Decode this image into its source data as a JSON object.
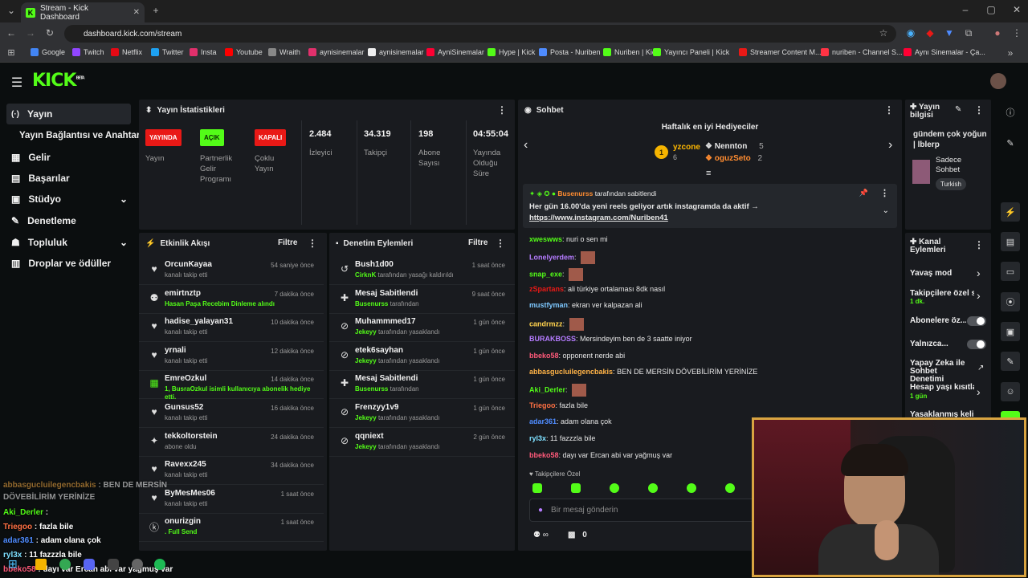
{
  "browser": {
    "tab_title": "Stream - Kick Dashboard",
    "url": "dashboard.kick.com/stream",
    "bookmarks": [
      "Google",
      "Twitch",
      "Netflix",
      "Twitter",
      "Insta",
      "Youtube",
      "Wraith",
      "aynisinemalar",
      "aynisinemalar",
      "AyniSinemalar",
      "Hype | Kick",
      "Posta - Nuriben",
      "Nuriben | Kick",
      "Yayıncı Paneli | Kick",
      "Streamer Content M...",
      "nuriben - Channel S...",
      "Aynı Sinemalar - Ça..."
    ]
  },
  "app": {
    "logo": "KICK",
    "logo_beta": "BETA"
  },
  "sidebar": {
    "items": [
      {
        "label": "Yayın",
        "icon": "broadcast-icon"
      },
      {
        "label": "Yayın Bağlantısı ve Anahtarı"
      },
      {
        "label": "Gelir",
        "icon": "revenue-icon"
      },
      {
        "label": "Başarılar",
        "icon": "achievements-icon"
      },
      {
        "label": "Stüdyo",
        "icon": "studio-icon"
      },
      {
        "label": "Denetleme",
        "icon": "wrench-icon"
      },
      {
        "label": "Topluluk",
        "icon": "community-icon"
      },
      {
        "label": "Droplar ve ödüller",
        "icon": "gift-icon"
      }
    ]
  },
  "stats": {
    "title": "Yayın İstatistikleri",
    "badges": [
      {
        "badge": "YAYINDA",
        "label": "Yayın",
        "color": "#e91916"
      },
      {
        "badge": "AÇIK",
        "label": "Partnerlik Gelir Programı",
        "color": "#53fc18"
      },
      {
        "badge": "KAPALI",
        "label": "Çoklu Yayın",
        "color": "#e91916"
      }
    ],
    "values": [
      {
        "value": "2.484",
        "label": "İzleyici"
      },
      {
        "value": "34.319",
        "label": "Takipçi"
      },
      {
        "value": "198",
        "label": "Abone Sayısı"
      },
      {
        "value": "04:55:04",
        "label": "Yayında Olduğu Süre"
      }
    ]
  },
  "activity": {
    "title": "Etkinlik Akışı",
    "filter": "Filtre",
    "rows": [
      {
        "name": "OrcunKayaa",
        "sub": "kanalı takip etti",
        "time": "54 saniye önce",
        "icon": "heart-icon"
      },
      {
        "name": "emirtnztp",
        "sub": "Hasan Paşa Recebim Dinleme alındı",
        "time": "7 dakika önce",
        "icon": "redeem-icon"
      },
      {
        "name": "hadise_yalayan31",
        "sub": "kanalı takip etti",
        "time": "10 dakika önce",
        "icon": "heart-icon"
      },
      {
        "name": "yrnali",
        "sub": "kanalı takip etti",
        "time": "12 dakika önce",
        "icon": "heart-icon"
      },
      {
        "name": "EmreOzkul",
        "sub": "1, BusraOzkul isimli kullanıcıya abonelik hediye etti.",
        "time": "14 dakika önce",
        "icon": "gift-sub-icon"
      },
      {
        "name": "Gunsus52",
        "sub": "kanalı takip etti",
        "time": "16 dakika önce",
        "icon": "heart-icon"
      },
      {
        "name": "tekkoltorstein",
        "sub": "abone oldu",
        "time": "24 dakika önce",
        "icon": "star-icon"
      },
      {
        "name": "Ravexx245",
        "sub": "kanalı takip etti",
        "time": "34 dakika önce",
        "icon": "heart-icon"
      },
      {
        "name": "ByMesMes06",
        "sub": "kanalı takip etti",
        "time": "1 saat önce",
        "icon": "heart-icon"
      },
      {
        "name": "onurizgin",
        "sub": ". Full Send",
        "time": "1 saat önce",
        "icon": "kick-icon"
      }
    ]
  },
  "moderation": {
    "title": "Denetim Eylemleri",
    "filter": "Filtre",
    "rows": [
      {
        "name": "Bush1d00",
        "sub_user": "CirknK",
        "sub": "tarafından yasağı kaldırıldı",
        "time": "1 saat önce",
        "icon": "undo-icon"
      },
      {
        "name": "Mesaj Sabitlendi",
        "sub_user": "Busenurss",
        "sub": "tarafından",
        "time": "9 saat önce",
        "icon": "pin-icon"
      },
      {
        "name": "Muhammmed17",
        "sub_user": "Jekeyy",
        "sub": "tarafından yasaklandı",
        "time": "1 gün önce",
        "icon": "ban-icon"
      },
      {
        "name": "etek6sayhan",
        "sub_user": "Jekeyy",
        "sub": "tarafından yasaklandı",
        "time": "1 gün önce",
        "icon": "ban-icon"
      },
      {
        "name": "Mesaj Sabitlendi",
        "sub_user": "Busenurss",
        "sub": "tarafından",
        "time": "1 gün önce",
        "icon": "pin-icon"
      },
      {
        "name": "Frenzyy1v9",
        "sub_user": "Jekeyy",
        "sub": "tarafından yasaklandı",
        "time": "1 gün önce",
        "icon": "ban-icon"
      },
      {
        "name": "qqniext",
        "sub_user": "Jekeyy",
        "sub": "tarafından yasaklandı",
        "time": "2 gün önce",
        "icon": "ban-icon"
      }
    ]
  },
  "chat": {
    "title": "Sohbet",
    "gifters_title": "Haftalık en iyi Hediyeciler",
    "gifters": [
      {
        "rank": "1",
        "name": "yzcone",
        "count": "6"
      },
      {
        "name": "Nennton",
        "count": "5"
      },
      {
        "name": "oguzSeto",
        "count": "2"
      }
    ],
    "pinned_by_user": "Busenurss",
    "pinned_by_suffix": "tarafından sabitlendi",
    "pinned_text": "Her gün 16.00'da yeni reels geliyor artık instagramda da aktif →",
    "pinned_link": "https://www.instagram.com/Nuriben41",
    "messages": [
      {
        "user": "xweswws",
        "color": "#53fc18",
        "text": "nuri o sen mi"
      },
      {
        "user": "Lonelyerdem",
        "color": "#b57cff",
        "text": ""
      },
      {
        "user": "snap_exe",
        "color": "#53fc18",
        "text": ""
      },
      {
        "user": "zSpartans",
        "color": "#e91916",
        "text": "ali türkiye ortalaması 8dk nasıl"
      },
      {
        "user": "mustfyman",
        "color": "#7ec8ff",
        "text": "ekran ver kalpazan ali"
      },
      {
        "user": "candrmzz",
        "color": "#ffd24d",
        "text": ""
      },
      {
        "user": "BURAKBOSS",
        "color": "#b57cff",
        "text": "Mersindeyim ben de 3 saatte iniyor"
      },
      {
        "user": "bbeko58",
        "color": "#ff5a7a",
        "text": "opponent nerde abi"
      },
      {
        "user": "abbasgucluilegencbakis",
        "color": "#ffb347",
        "text": "BEN DE MERSİN DÖVEBİLİRİM YERİNİZE"
      },
      {
        "user": "Aki_Derler",
        "color": "#53fc18",
        "text": ""
      },
      {
        "user": "Triegoo",
        "color": "#ff7043",
        "text": "fazla bile"
      },
      {
        "user": "adar361",
        "color": "#4f8cff",
        "text": "adam olana çok"
      },
      {
        "user": "ryl3x",
        "color": "#7ee0ff",
        "text": "11 fazzzla bile"
      },
      {
        "user": "bbeko58",
        "color": "#ff5a7a",
        "text": "dayı var Ercan abi var yağmuş var"
      }
    ],
    "followers_only": "Takipçilere Özel",
    "input_placeholder": "Bir mesaj gönderin",
    "counter": "0"
  },
  "stream_info": {
    "title": "Yayın bilgisi",
    "stream_title": "gündem çok yoğun | lblerp",
    "category": "Sadece Sohbet",
    "language": "Turkish"
  },
  "channel_actions": {
    "title": "Kanal Eylemleri",
    "items": [
      {
        "label": "Yavaş mod"
      },
      {
        "label": "Takipçilere özel s",
        "sub": "1 dk."
      },
      {
        "label": "Abonelere öz..."
      },
      {
        "label": "Yalnızca..."
      },
      {
        "label": "Yapay Zeka ile Sohbet Denetimi"
      },
      {
        "label": "Hesap yaşı kısıtla",
        "sub": "1 gün"
      },
      {
        "label": "Yasaklanmış kelin"
      }
    ]
  },
  "overlay_chat": [
    {
      "user": "abbasgucluilegencbakis",
      "text": "BEN DE MERSİN DÖVEBİLİRİM YERİNİZE",
      "color": "#ffb347"
    },
    {
      "user": "Aki_Derler",
      "text": "",
      "color": "#53fc18"
    },
    {
      "user": "Triegoo",
      "text": "fazla bile",
      "color": "#ff7043"
    },
    {
      "user": "adar361",
      "text": "adam olana çok",
      "color": "#4f8cff"
    },
    {
      "user": "ryl3x",
      "text": "11 fazzzla bile",
      "color": "#7ee0ff"
    },
    {
      "user": "bbeko58",
      "text": "dayı var Ercan abi var yağmuş var",
      "color": "#ff5a7a"
    }
  ]
}
